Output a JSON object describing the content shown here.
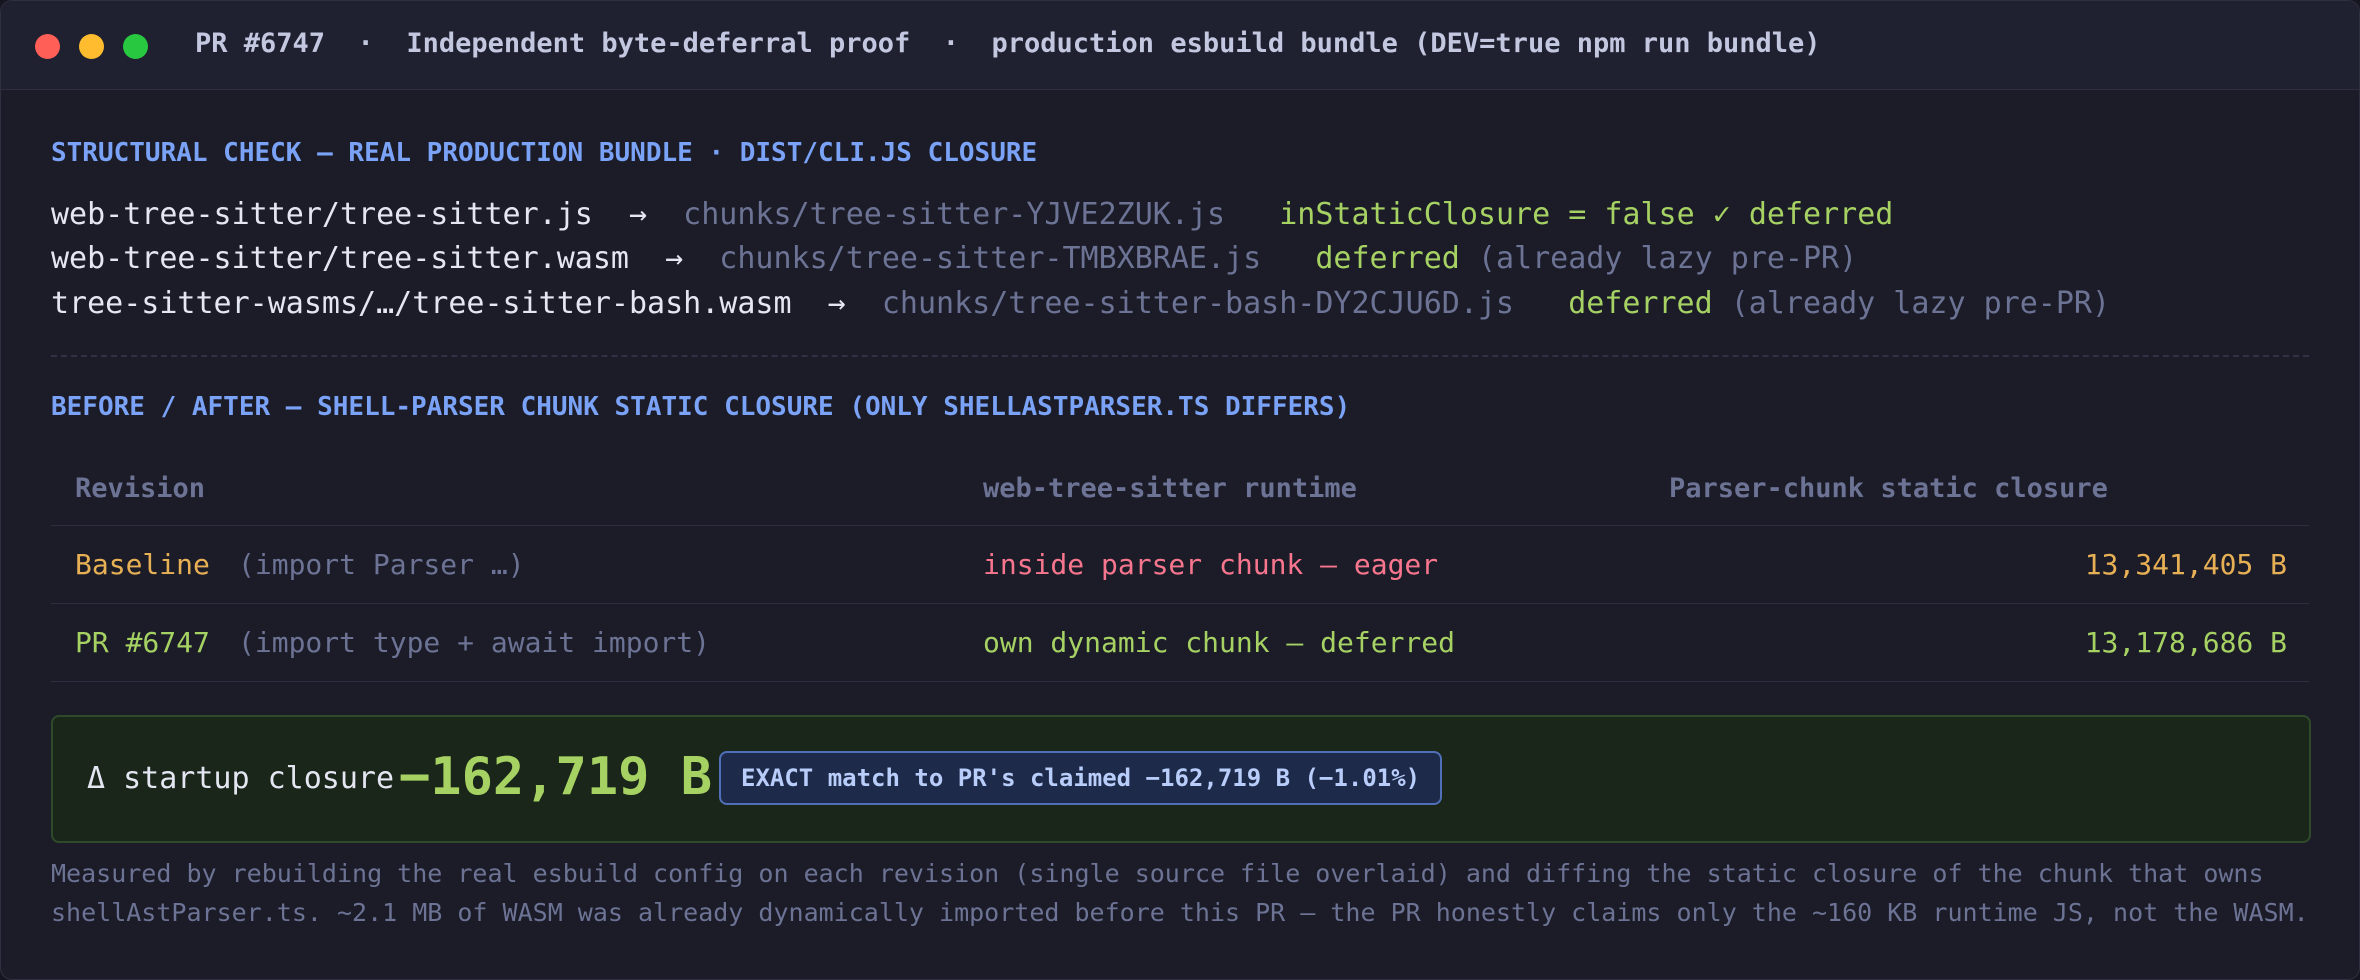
{
  "window": {
    "title": "PR #6747  ·  Independent byte-deferral proof  ·  production esbuild bundle (DEV=true npm run bundle)"
  },
  "structural": {
    "heading": "STRUCTURAL CHECK — REAL PRODUCTION BUNDLE · DIST/CLI.JS CLOSURE",
    "rows": [
      {
        "source": "web-tree-sitter/tree-sitter.js",
        "arrow": "→",
        "chunk": "chunks/tree-sitter-YJVE2ZUK.js",
        "status": "inStaticClosure = false ✓ deferred",
        "note": ""
      },
      {
        "source": "web-tree-sitter/tree-sitter.wasm",
        "arrow": "→",
        "chunk": "chunks/tree-sitter-TMBXBRAE.js",
        "status": "deferred",
        "note": "(already lazy pre-PR)"
      },
      {
        "source": "tree-sitter-wasms/…/tree-sitter-bash.wasm",
        "arrow": "→",
        "chunk": "chunks/tree-sitter-bash-DY2CJU6D.js",
        "status": "deferred",
        "note": "(already lazy pre-PR)"
      }
    ]
  },
  "comparison": {
    "heading": "BEFORE / AFTER — SHELL-PARSER CHUNK STATIC CLOSURE (ONLY SHELLASTPARSER.TS DIFFERS)",
    "columns": [
      "Revision",
      "web-tree-sitter runtime",
      "Parser-chunk static closure"
    ],
    "rows": [
      {
        "revision": "Baseline",
        "detail": "(import Parser …)",
        "runtime": "inside parser chunk — eager",
        "closure": "13,341,405 B"
      },
      {
        "revision": "PR #6747",
        "detail": "(import type + await import)",
        "runtime": "own dynamic chunk — deferred",
        "closure": "13,178,686 B"
      }
    ]
  },
  "delta": {
    "label": "Δ startup closure",
    "value": "−162,719 B",
    "badge": "EXACT match to PR's claimed −162,719 B (−1.01%)"
  },
  "footnote": {
    "line1": "Measured by rebuilding the real esbuild config on each revision (single source file overlaid) and diffing the static closure of the chunk that owns",
    "line2": "shellAstParser.ts. ~2.1 MB of WASM was already dynamically imported before this PR — the PR honestly claims only the ~160 KB runtime JS, not the WASM."
  },
  "colors": {
    "accent": "#7aa2f7",
    "positive": "#a6d163",
    "negative": "#f7768e",
    "baseline": "#e8b055",
    "muted": "#6c7394"
  }
}
